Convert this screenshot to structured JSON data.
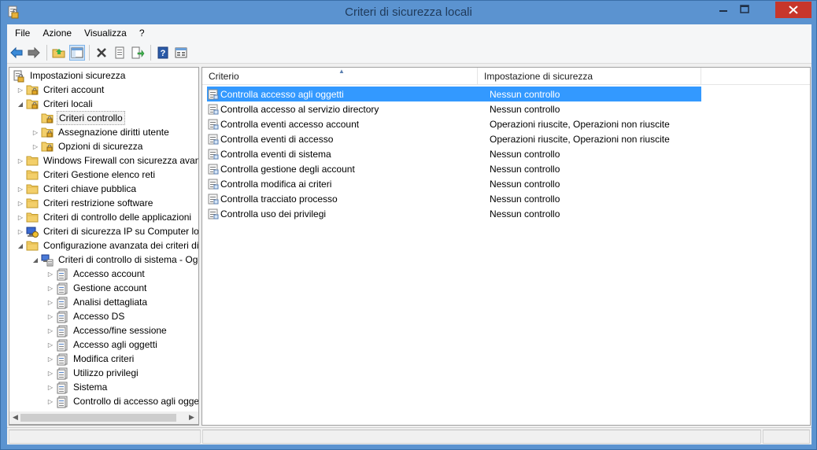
{
  "window": {
    "title": "Criteri di sicurezza locali"
  },
  "menu": [
    {
      "label": "File"
    },
    {
      "label": "Azione"
    },
    {
      "label": "Visualizza"
    },
    {
      "label": "?"
    }
  ],
  "toolbar": {
    "icons": [
      "back-arrow-icon",
      "forward-arrow-icon",
      "up-folder-icon",
      "show-hide-tree-icon",
      "delete-icon",
      "properties-icon",
      "export-list-icon",
      "help-icon",
      "toggle-view-icon"
    ]
  },
  "tree": {
    "items": [
      {
        "label": "Impostazioni sicurezza",
        "level": 0,
        "arrow": "",
        "icon": "policy-root-icon"
      },
      {
        "label": "Criteri account",
        "level": 1,
        "arrow": "collapsed",
        "icon": "folder-lock-icon"
      },
      {
        "label": "Criteri locali",
        "level": 1,
        "arrow": "expanded",
        "icon": "folder-lock-icon"
      },
      {
        "label": "Criteri controllo",
        "level": 2,
        "arrow": "",
        "icon": "folder-lock-icon",
        "selected": true
      },
      {
        "label": "Assegnazione diritti utente",
        "level": 2,
        "arrow": "collapsed",
        "icon": "folder-lock-icon"
      },
      {
        "label": "Opzioni di sicurezza",
        "level": 2,
        "arrow": "collapsed",
        "icon": "folder-lock-icon"
      },
      {
        "label": "Windows Firewall con sicurezza avanzata",
        "level": 1,
        "arrow": "collapsed",
        "icon": "folder-icon"
      },
      {
        "label": "Criteri Gestione elenco reti",
        "level": 1,
        "arrow": "",
        "icon": "folder-icon"
      },
      {
        "label": "Criteri chiave pubblica",
        "level": 1,
        "arrow": "collapsed",
        "icon": "folder-icon"
      },
      {
        "label": "Criteri restrizione software",
        "level": 1,
        "arrow": "collapsed",
        "icon": "folder-icon"
      },
      {
        "label": "Criteri di controllo delle applicazioni",
        "level": 1,
        "arrow": "collapsed",
        "icon": "folder-icon"
      },
      {
        "label": "Criteri di sicurezza IP su Computer locale",
        "level": 1,
        "arrow": "collapsed",
        "icon": "ip-security-icon"
      },
      {
        "label": "Configurazione avanzata dei criteri di controllo",
        "level": 1,
        "arrow": "expanded",
        "icon": "folder-icon"
      },
      {
        "label": "Criteri di controllo di sistema - Oggetto Criteri di gruppo locale",
        "level": 2,
        "arrow": "expanded",
        "icon": "computer-policy-icon"
      },
      {
        "label": "Accesso account",
        "level": 3,
        "arrow": "collapsed",
        "icon": "audit-doc-icon"
      },
      {
        "label": "Gestione account",
        "level": 3,
        "arrow": "collapsed",
        "icon": "audit-doc-icon"
      },
      {
        "label": "Analisi dettagliata",
        "level": 3,
        "arrow": "collapsed",
        "icon": "audit-doc-icon"
      },
      {
        "label": "Accesso DS",
        "level": 3,
        "arrow": "collapsed",
        "icon": "audit-doc-icon"
      },
      {
        "label": "Accesso/fine sessione",
        "level": 3,
        "arrow": "collapsed",
        "icon": "audit-doc-icon"
      },
      {
        "label": "Accesso agli oggetti",
        "level": 3,
        "arrow": "collapsed",
        "icon": "audit-doc-icon"
      },
      {
        "label": "Modifica criteri",
        "level": 3,
        "arrow": "collapsed",
        "icon": "audit-doc-icon"
      },
      {
        "label": "Utilizzo privilegi",
        "level": 3,
        "arrow": "collapsed",
        "icon": "audit-doc-icon"
      },
      {
        "label": "Sistema",
        "level": 3,
        "arrow": "collapsed",
        "icon": "audit-doc-icon"
      },
      {
        "label": "Controllo di accesso agli oggetti globale",
        "level": 3,
        "arrow": "collapsed",
        "icon": "audit-doc-icon"
      }
    ]
  },
  "list": {
    "columns": [
      {
        "label": "Criterio"
      },
      {
        "label": "Impostazione di sicurezza"
      }
    ],
    "rows": [
      {
        "policy": "Controlla accesso agli oggetti",
        "setting": "Nessun controllo",
        "selected": true
      },
      {
        "policy": "Controlla accesso al servizio directory",
        "setting": "Nessun controllo"
      },
      {
        "policy": "Controlla eventi accesso account",
        "setting": "Operazioni riuscite, Operazioni non riuscite"
      },
      {
        "policy": "Controlla eventi di accesso",
        "setting": "Operazioni riuscite, Operazioni non riuscite"
      },
      {
        "policy": "Controlla eventi di sistema",
        "setting": "Nessun controllo"
      },
      {
        "policy": "Controlla gestione degli account",
        "setting": "Nessun controllo"
      },
      {
        "policy": "Controlla modifica ai criteri",
        "setting": "Nessun controllo"
      },
      {
        "policy": "Controlla tracciato processo",
        "setting": "Nessun controllo"
      },
      {
        "policy": "Controlla uso dei privilegi",
        "setting": "Nessun controllo"
      }
    ]
  },
  "colors": {
    "titlebar": "#5b93d0",
    "close": "#c7362b",
    "selection": "#3399ff"
  }
}
